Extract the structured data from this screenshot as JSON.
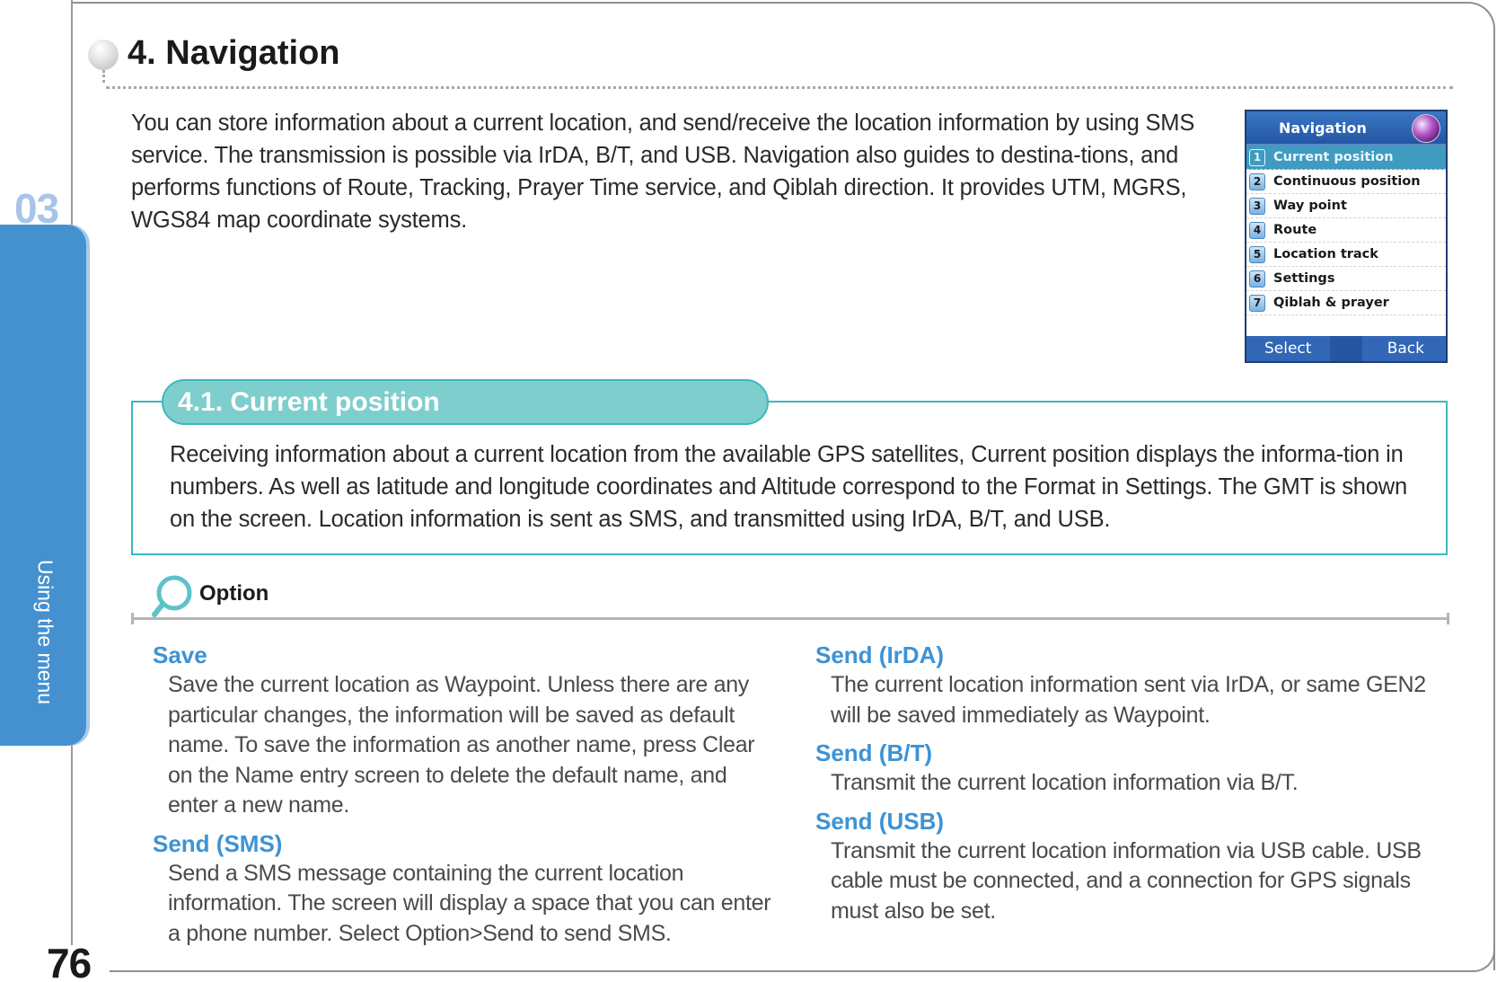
{
  "chapter": {
    "number": "03",
    "label": "Using the menu"
  },
  "page_number": "76",
  "header": {
    "title": "4. Navigation"
  },
  "intro": "You can store information about a current location, and send/receive the location information by using SMS service. The transmission is possible via IrDA, B/T, and USB. Navigation also guides to destina-tions, and performs functions of Route, Tracking, Prayer Time service, and Qiblah direction. It provides UTM, MGRS, WGS84 map coordinate systems.",
  "phone_screen": {
    "title": "Navigation",
    "icon": "globe-icon",
    "items": [
      {
        "num": "1",
        "label": "Current position",
        "selected": true
      },
      {
        "num": "2",
        "label": "Continuous position",
        "selected": false
      },
      {
        "num": "3",
        "label": "Way point",
        "selected": false
      },
      {
        "num": "4",
        "label": "Route",
        "selected": false
      },
      {
        "num": "5",
        "label": "Location track",
        "selected": false
      },
      {
        "num": "6",
        "label": "Settings",
        "selected": false
      },
      {
        "num": "7",
        "label": "Qiblah & prayer",
        "selected": false
      }
    ],
    "softkeys": {
      "left": "Select",
      "right": "Back"
    }
  },
  "section": {
    "title": "4.1. Current position",
    "body": "Receiving information about a current location from the available GPS satellites, Current position displays the informa-tion in numbers. As well as latitude and longitude coordinates and Altitude correspond to the Format in Settings. The GMT is shown on the screen. Location information is sent as SMS, and transmitted using IrDA, B/T, and USB."
  },
  "options": {
    "label": "Option",
    "left": [
      {
        "title": "Save",
        "desc": "Save the current location as Waypoint. Unless there are any particular changes, the information will be saved as default name. To save the information as another name, press Clear on the Name entry screen to delete the default name, and enter a new name."
      },
      {
        "title": "Send (SMS)",
        "desc": "Send a SMS message containing the current location information. The screen will display a space that you can enter a phone number. Select Option>Send to send SMS."
      }
    ],
    "right": [
      {
        "title": "Send (IrDA)",
        "desc": "The current location information sent via IrDA, or same GEN2 will be saved immediately as Waypoint."
      },
      {
        "title": "Send (B/T)",
        "desc": "Transmit the current location information via B/T."
      },
      {
        "title": "Send (USB)",
        "desc": "Transmit the current location information via USB cable. USB cable must be connected, and a connection for GPS signals must also be set."
      }
    ]
  },
  "colors": {
    "chapter_tab": "#4591d0",
    "chapter_number": "#a6c5e8",
    "section_teal": "#7ecece",
    "section_border": "#3cb8bf",
    "option_title_blue": "#3d93d4"
  }
}
